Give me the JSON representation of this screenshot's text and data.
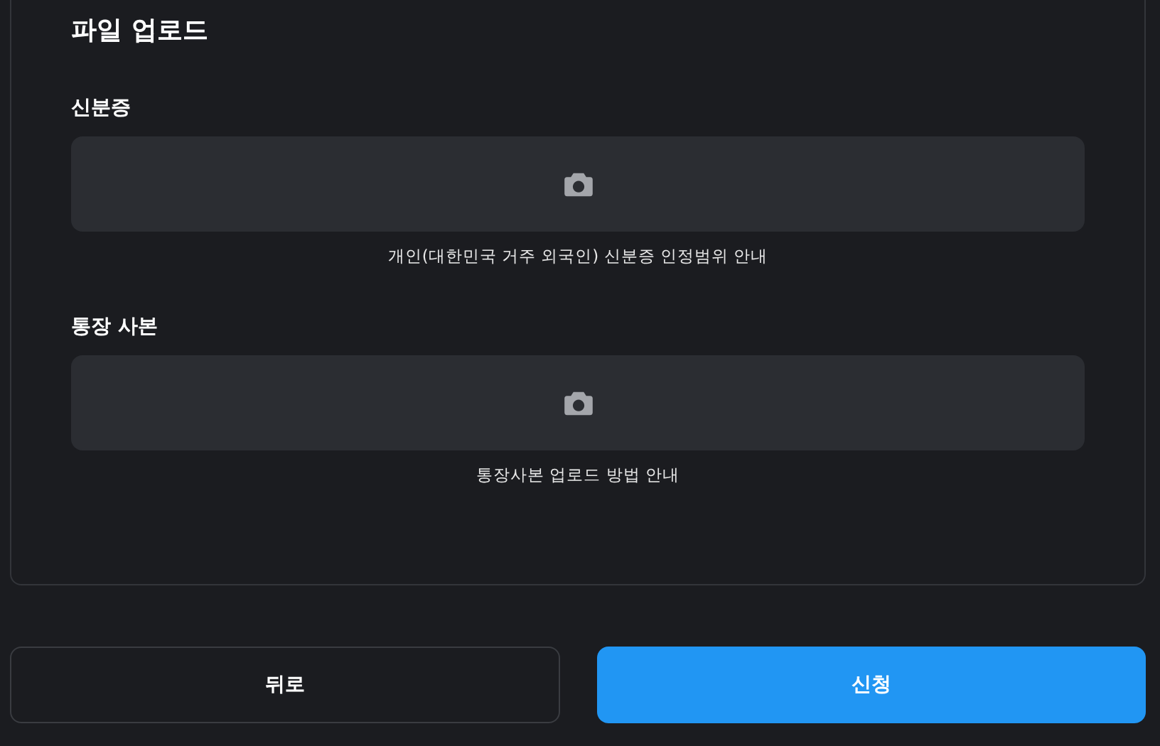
{
  "section_title": "파일 업로드",
  "uploads": [
    {
      "label": "신분증",
      "guide": "개인(대한민국 거주 외국인) 신분증 인정범위 안내"
    },
    {
      "label": "통장 사본",
      "guide": "통장사본 업로드 방법 안내"
    }
  ],
  "buttons": [
    {
      "label": "뒤로",
      "kind": "outline"
    },
    {
      "label": "신청",
      "kind": "primary"
    }
  ]
}
